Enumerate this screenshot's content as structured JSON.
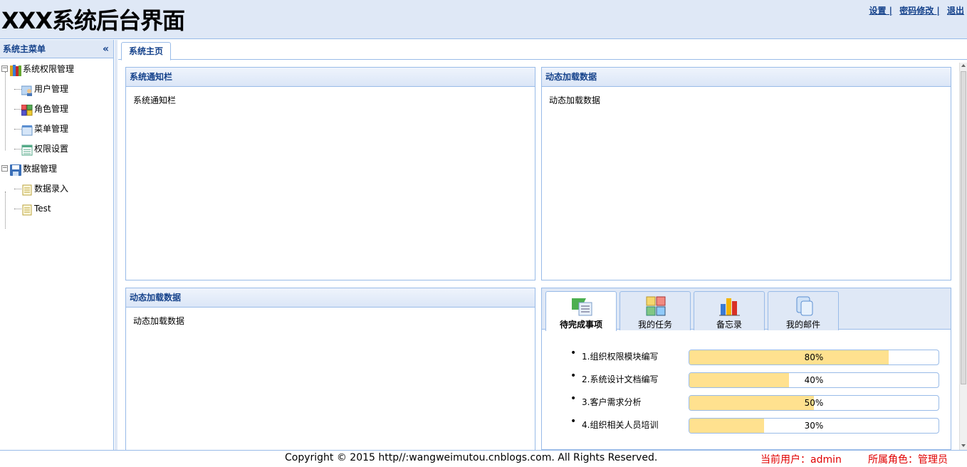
{
  "header": {
    "title": "XXX系统后台界面",
    "links": [
      "设置 |",
      "密码修改 |",
      "退出"
    ]
  },
  "sidebar": {
    "title": "系统主菜单",
    "collapse_glyph": "«",
    "groups": [
      {
        "label": "系统权限管理",
        "expander": "−",
        "items": [
          {
            "label": "用户管理",
            "icon": "user-icon"
          },
          {
            "label": "角色管理",
            "icon": "role-icon"
          },
          {
            "label": "菜单管理",
            "icon": "menu-icon"
          },
          {
            "label": "权限设置",
            "icon": "permission-icon"
          }
        ]
      },
      {
        "label": "数据管理",
        "expander": "−",
        "items": [
          {
            "label": "数据录入",
            "icon": "document-icon"
          },
          {
            "label": "Test",
            "icon": "document-icon"
          }
        ]
      }
    ]
  },
  "main": {
    "tab_label": "系统主页",
    "panels": {
      "notice": {
        "title": "系统通知栏",
        "body": "系统通知栏"
      },
      "dynamic1": {
        "title": "动态加载数据",
        "body": "动态加载数据"
      },
      "dynamic2": {
        "title": "动态加载数据",
        "body": "动态加载数据"
      }
    },
    "task_tabs": {
      "tabs": [
        "待完成事项",
        "我的任务",
        "备忘录",
        "我的邮件"
      ],
      "active_index": 0,
      "tasks": [
        {
          "name": "1.组织权限模块编写",
          "progress": 80,
          "label": "80%"
        },
        {
          "name": "2.系统设计文档编写",
          "progress": 40,
          "label": "40%"
        },
        {
          "name": "3.客户需求分析",
          "progress": 50,
          "label": "50%"
        },
        {
          "name": "4.组织相关人员培训",
          "progress": 30,
          "label": "30%"
        }
      ]
    }
  },
  "footer": {
    "copyright": "Copyright © 2015 http//:wangweimutou.cnblogs.com. All Rights Reserved.",
    "current_user": "当前用户：admin",
    "role": "所属角色：管理员"
  },
  "colors": {
    "header_bg": "#dfe8f6",
    "border": "#99bbe8",
    "title_blue": "#15428b",
    "progress_fill": "#ffe18f",
    "footer_red": "#e00000"
  }
}
